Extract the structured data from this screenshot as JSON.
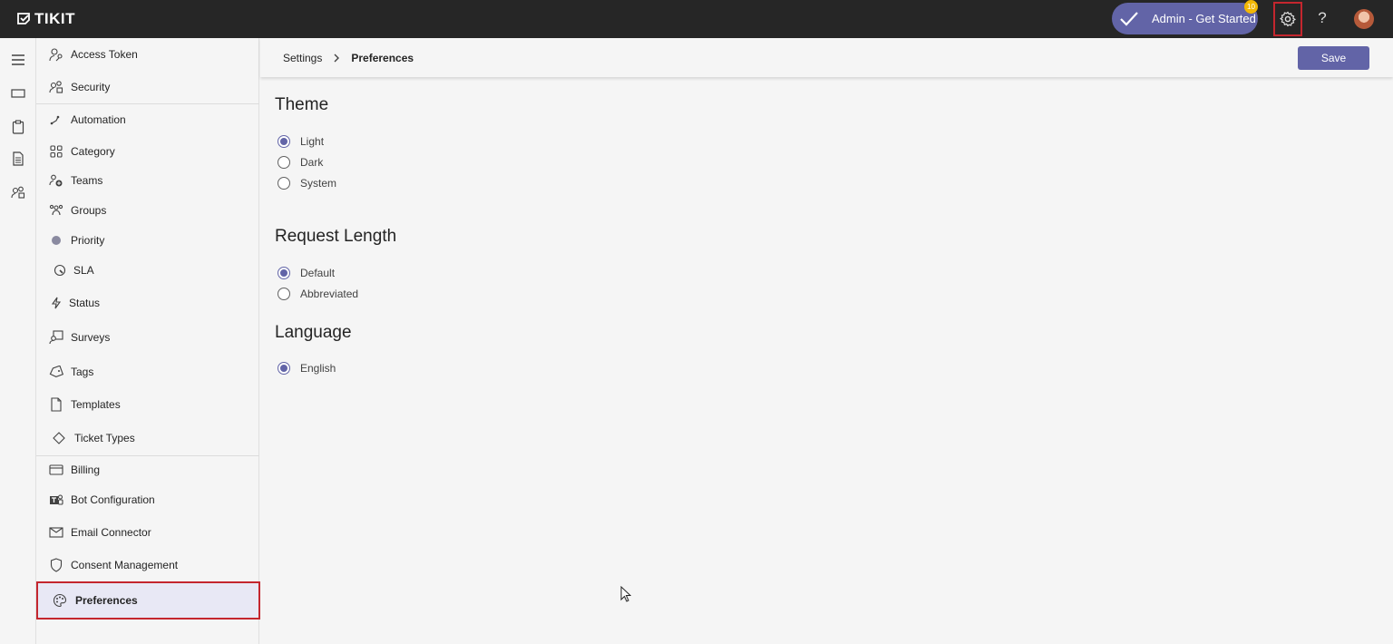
{
  "app": {
    "name": "TIKIT"
  },
  "topbar": {
    "get_started_label": "Admin - Get Started",
    "get_started_badge": "10",
    "help_label": "?"
  },
  "rail": {
    "items": [
      "menu-icon",
      "tickets-icon",
      "clipboard-icon",
      "document-icon",
      "people-icon"
    ]
  },
  "sidebar": {
    "items": [
      {
        "label": "Access Token",
        "icon": "key-person-icon"
      },
      {
        "label": "Security",
        "icon": "people-lock-icon"
      },
      {
        "label": "Automation",
        "icon": "flow-icon"
      },
      {
        "label": "Category",
        "icon": "grid-icon"
      },
      {
        "label": "Teams",
        "icon": "teams-icon"
      },
      {
        "label": "Groups",
        "icon": "groups-icon"
      },
      {
        "label": "Priority",
        "icon": "dot-icon"
      },
      {
        "label": "SLA",
        "icon": "gauge-icon"
      },
      {
        "label": "Status",
        "icon": "lightning-icon"
      },
      {
        "label": "Surveys",
        "icon": "survey-icon"
      },
      {
        "label": "Tags",
        "icon": "tag-icon"
      },
      {
        "label": "Templates",
        "icon": "template-icon"
      },
      {
        "label": "Ticket Types",
        "icon": "diamond-icon"
      },
      {
        "label": "Billing",
        "icon": "card-icon"
      },
      {
        "label": "Bot Configuration",
        "icon": "bot-icon"
      },
      {
        "label": "Email Connector",
        "icon": "mail-icon"
      },
      {
        "label": "Consent Management",
        "icon": "shield-icon"
      },
      {
        "label": "Preferences",
        "icon": "palette-icon"
      }
    ]
  },
  "breadcrumb": {
    "root": "Settings",
    "current": "Preferences"
  },
  "save_label": "Save",
  "sections": {
    "theme": {
      "title": "Theme",
      "options": [
        "Light",
        "Dark",
        "System"
      ],
      "selected": "Light"
    },
    "request_length": {
      "title": "Request Length",
      "options": [
        "Default",
        "Abbreviated"
      ],
      "selected": "Default"
    },
    "language": {
      "title": "Language",
      "options": [
        "English"
      ],
      "selected": "English"
    }
  },
  "colors": {
    "accent": "#6264a7",
    "topbar": "#262626",
    "highlight": "#c4262e"
  }
}
